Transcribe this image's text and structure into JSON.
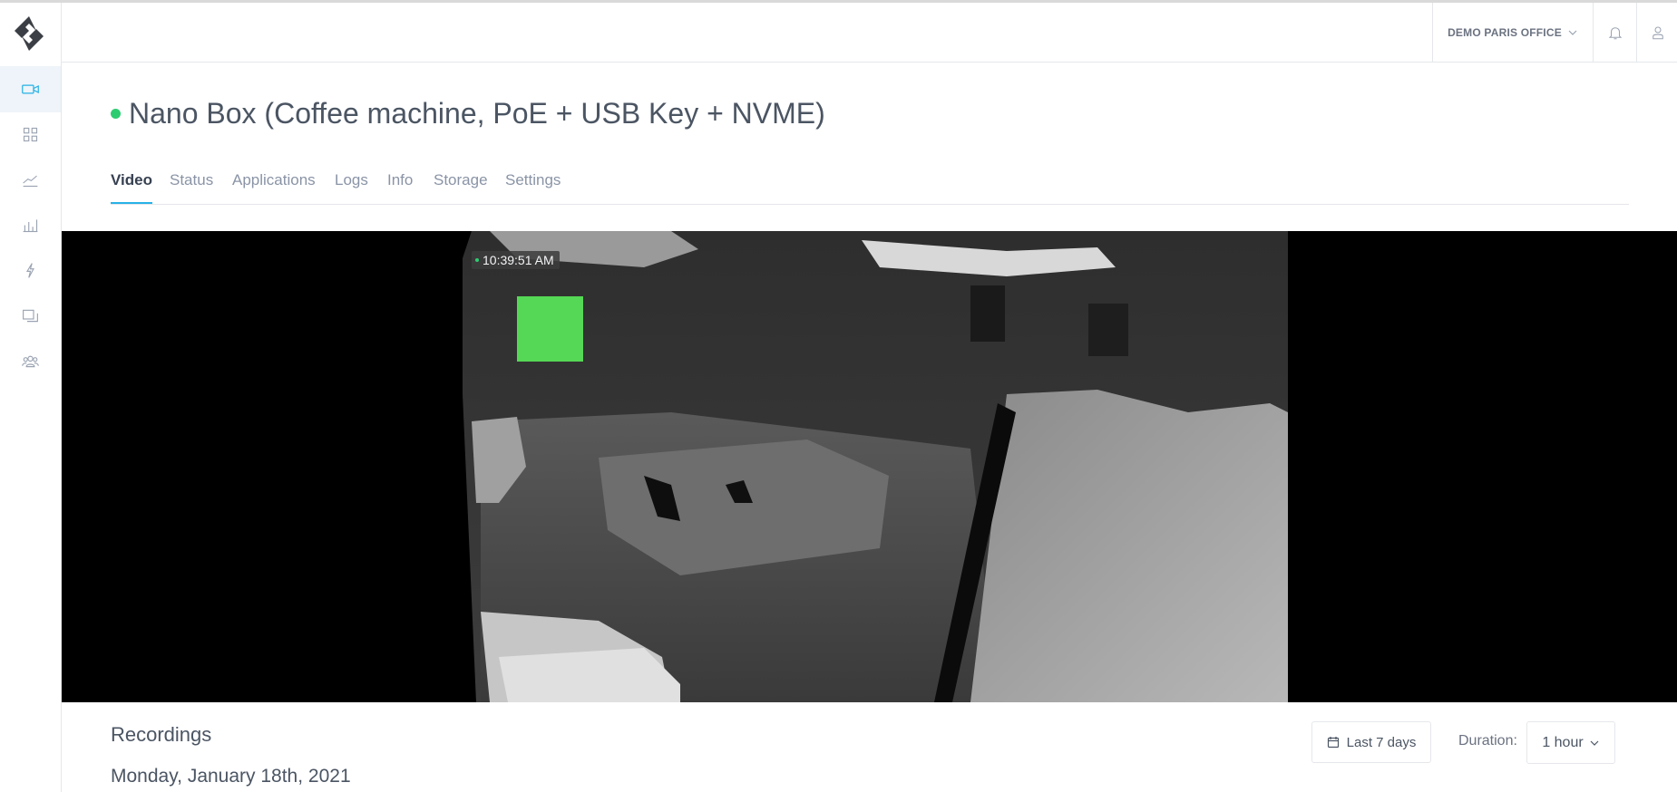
{
  "header": {
    "site": "DEMO PARIS OFFICE"
  },
  "sidebar": {
    "items": [
      {
        "icon": "video-camera-icon",
        "active": true
      },
      {
        "icon": "grid-icon"
      },
      {
        "icon": "line-chart-icon"
      },
      {
        "icon": "bar-chart-icon"
      },
      {
        "icon": "lightning-icon"
      },
      {
        "icon": "screens-icon"
      },
      {
        "icon": "users-icon"
      }
    ]
  },
  "device": {
    "title": "Nano Box (Coffee machine, PoE + USB Key + NVME)",
    "status_color": "#2ecc71"
  },
  "tabs": [
    "Video",
    "Status",
    "Applications",
    "Logs",
    "Info",
    "Storage",
    "Settings"
  ],
  "video": {
    "timestamp": "10:39:51 AM",
    "overlay_color": "#55d855"
  },
  "recordings": {
    "title": "Recordings",
    "date": "Monday, January 18th, 2021",
    "range_label": "Last 7 days",
    "duration_label": "Duration:",
    "duration_value": "1 hour"
  },
  "colors": {
    "accent": "#27b1e6",
    "sidebar_active_bg": "#eef4f9"
  }
}
